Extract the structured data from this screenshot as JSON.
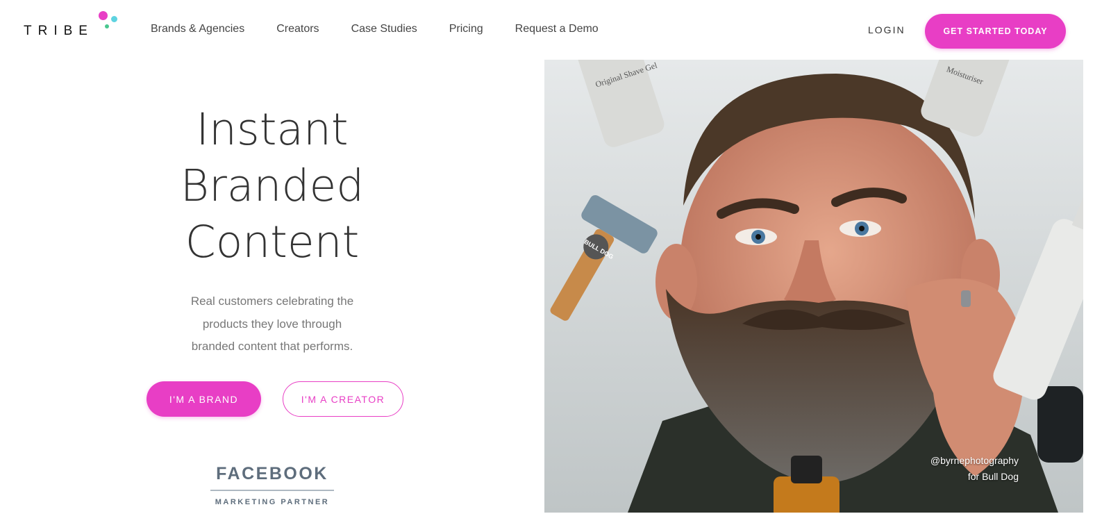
{
  "brand": {
    "logo_text": "TRIBE",
    "accent": "#e83ec5",
    "dot_colors": [
      "#e83ec5",
      "#5ed3e0",
      "#49c78f"
    ]
  },
  "nav": {
    "items": [
      {
        "label": "Brands & Agencies"
      },
      {
        "label": "Creators"
      },
      {
        "label": "Case Studies"
      },
      {
        "label": "Pricing"
      },
      {
        "label": "Request a Demo"
      }
    ],
    "login": "LOGIN",
    "cta": "GET STARTED TODAY"
  },
  "hero": {
    "title_lines": [
      "Instant",
      "Branded",
      "Content"
    ],
    "subtitle_lines": [
      "Real customers celebrating the",
      "products they love through",
      "branded content that performs."
    ],
    "brand_button": "I'M A BRAND",
    "creator_button": "I'M A CREATOR",
    "badge": {
      "name": "FACEBOOK",
      "tagline": "MARKETING PARTNER"
    }
  },
  "photo": {
    "caption_line1": "@byrnephotography",
    "caption_line2": "for Bull Dog",
    "product_labels": {
      "shave_gel": "Original Shave Gel",
      "moisturizer": "Moisturiser",
      "razor": "BULL DOG"
    }
  }
}
